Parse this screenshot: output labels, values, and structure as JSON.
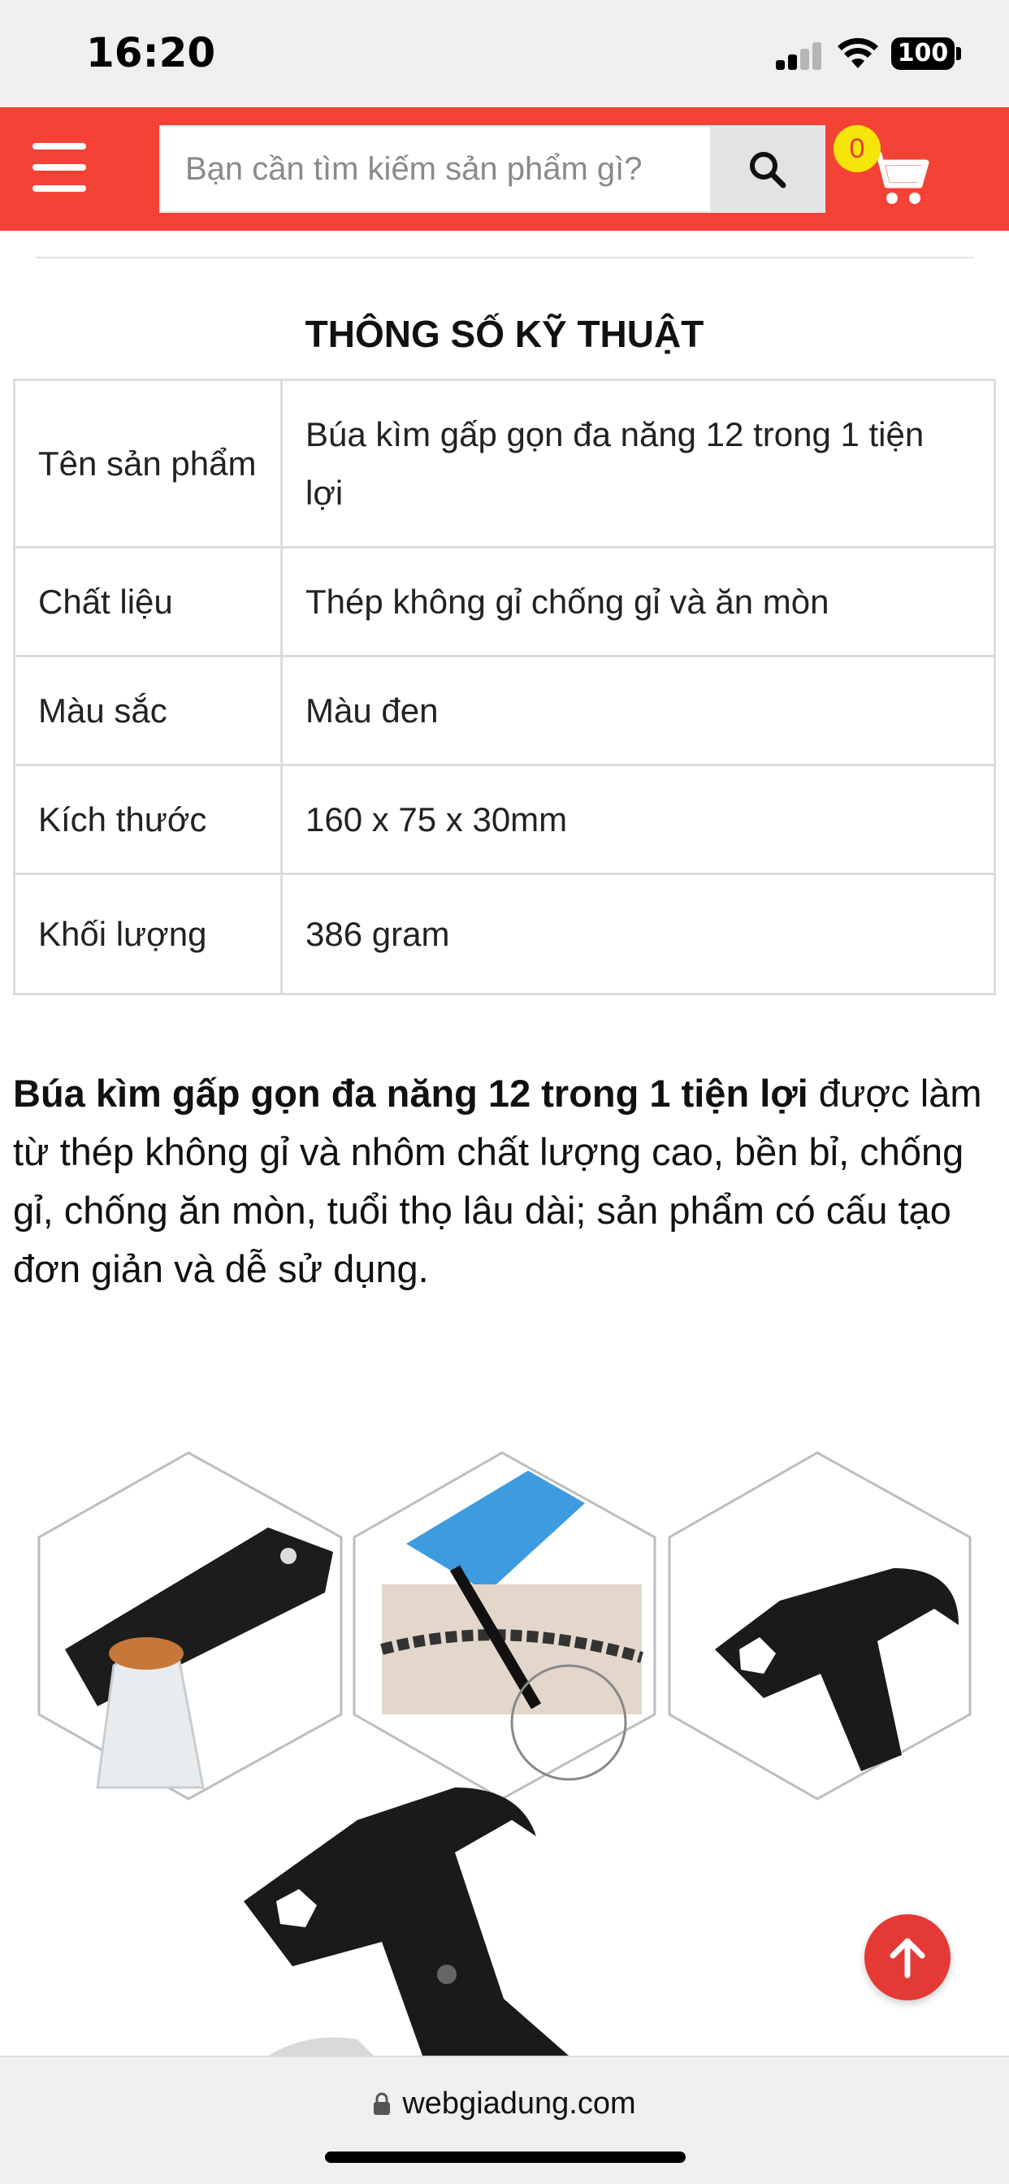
{
  "status_bar": {
    "time": "16:20",
    "battery": "100"
  },
  "header": {
    "search_placeholder": "Bạn cần tìm kiếm sản phẩm gì?",
    "cart_count": "0",
    "brand_color": "#f44336"
  },
  "specs": {
    "title": "THÔNG SỐ KỸ THUẬT",
    "rows": [
      {
        "label": "Tên sản phẩm",
        "value": "Búa kìm gấp gọn đa năng 12 trong 1 tiện lợi"
      },
      {
        "label": "Chất liệu",
        "value": "Thép không gỉ chống gỉ và ăn mòn"
      },
      {
        "label": "Màu sắc",
        "value": "Màu đen"
      },
      {
        "label": "Kích thước",
        "value": "160 x 75 x 30mm"
      },
      {
        "label": "Khối lượng",
        "value": "386 gram"
      }
    ]
  },
  "description": {
    "bold": "Búa kìm gấp gọn đa năng 12 trong 1 tiện lợi",
    "text": " được làm từ thép không gỉ và nhôm chất lượng cao, bền bỉ, chống gỉ, chống ăn mòn, tuổi thọ lâu dài; sản phẩm có cấu tạo đơn giản và dễ sử dụng."
  },
  "browser": {
    "url": "webgiadung.com"
  },
  "icons": {
    "menu": "hamburger-icon",
    "search": "search-icon",
    "cart": "cart-icon",
    "scroll_top": "arrow-up-icon",
    "lock": "lock-icon"
  }
}
